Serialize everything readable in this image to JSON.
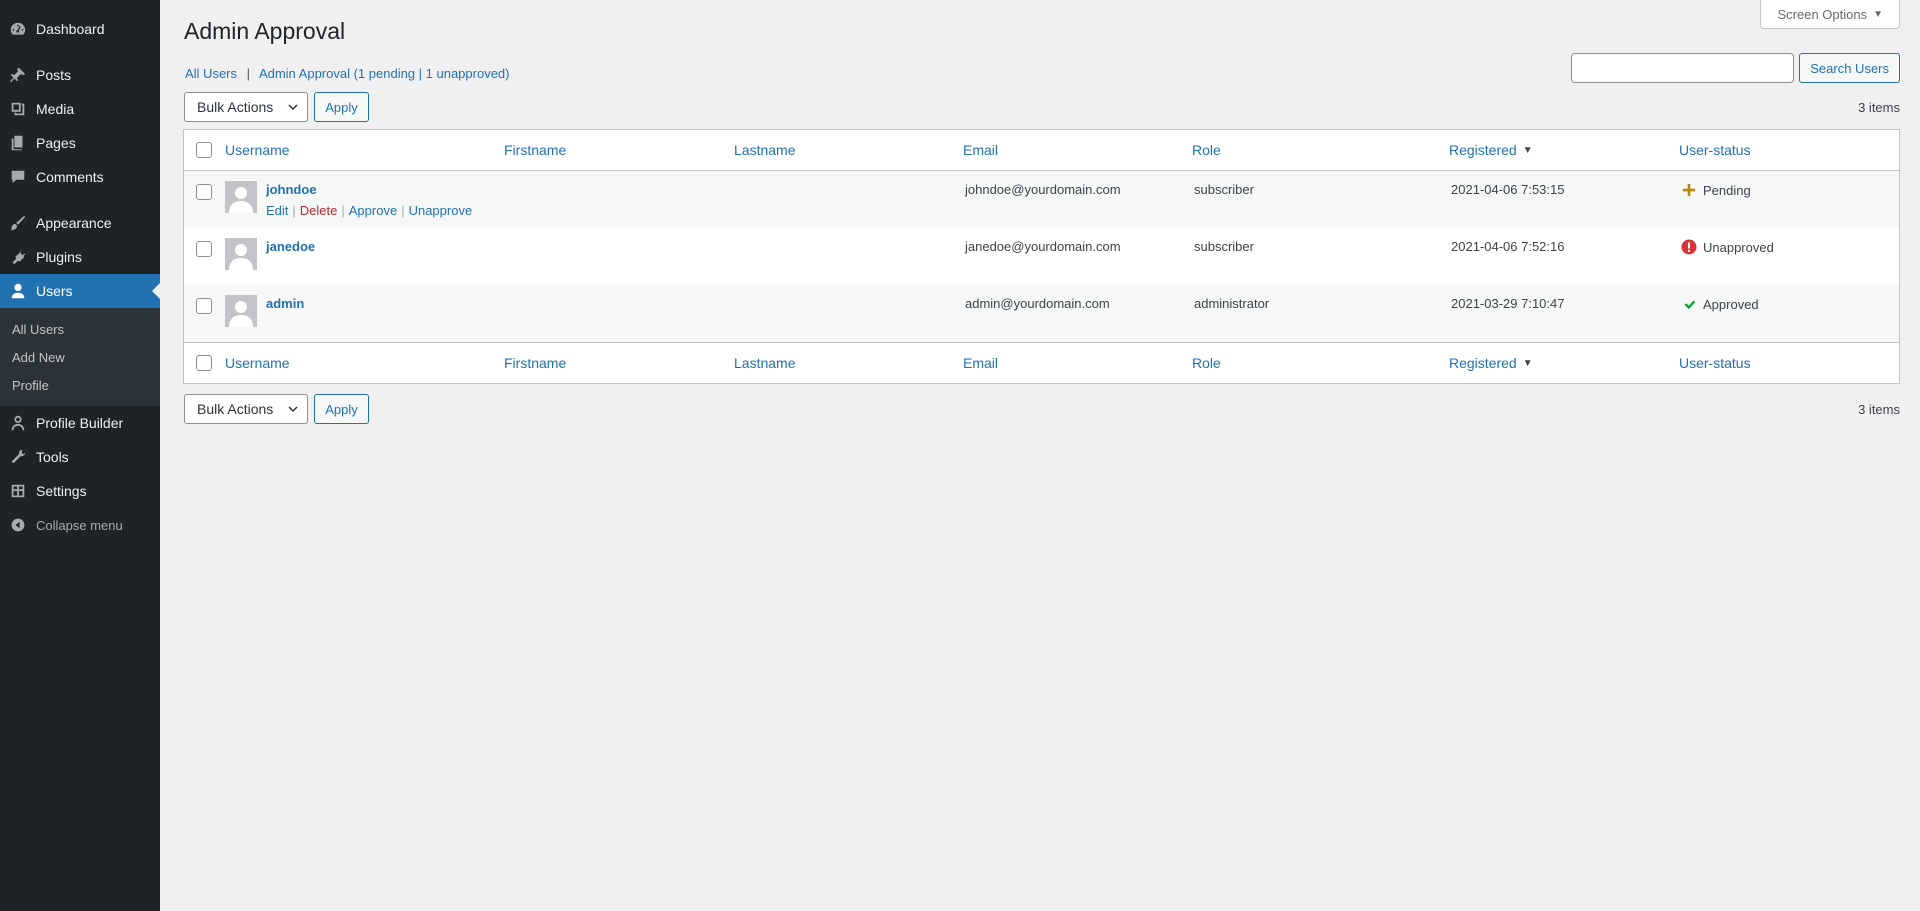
{
  "sidebar": {
    "items": [
      {
        "label": "Dashboard",
        "icon": "dashboard-icon"
      },
      {
        "label": "Posts",
        "icon": "pin-icon"
      },
      {
        "label": "Media",
        "icon": "media-icon"
      },
      {
        "label": "Pages",
        "icon": "pages-icon"
      },
      {
        "label": "Comments",
        "icon": "comment-icon"
      },
      {
        "label": "Appearance",
        "icon": "brush-icon"
      },
      {
        "label": "Plugins",
        "icon": "plug-icon"
      },
      {
        "label": "Users",
        "icon": "user-icon"
      },
      {
        "label": "Profile Builder",
        "icon": "user-outline-icon"
      },
      {
        "label": "Tools",
        "icon": "wrench-icon"
      },
      {
        "label": "Settings",
        "icon": "settings-icon"
      }
    ],
    "submenu": [
      "All Users",
      "Add New",
      "Profile"
    ],
    "collapse_label": "Collapse menu"
  },
  "header": {
    "screen_options": "Screen Options",
    "title": "Admin Approval"
  },
  "filters": {
    "all_users": "All Users",
    "admin_approval": "Admin Approval (1 pending | 1 unapproved)"
  },
  "search": {
    "button": "Search Users",
    "value": ""
  },
  "tablenav": {
    "bulk_actions": "Bulk Actions",
    "apply": "Apply",
    "count": "3 items"
  },
  "table": {
    "columns": {
      "username": "Username",
      "firstname": "Firstname",
      "lastname": "Lastname",
      "email": "Email",
      "role": "Role",
      "registered": "Registered",
      "status": "User-status"
    },
    "row_actions": {
      "edit": "Edit",
      "delete": "Delete",
      "approve": "Approve",
      "unapprove": "Unapprove"
    },
    "rows": [
      {
        "username": "johndoe",
        "email": "johndoe@yourdomain.com",
        "role": "subscriber",
        "registered": "2021-04-06 7:53:15",
        "status": "Pending",
        "status_color": "#b8860b"
      },
      {
        "username": "janedoe",
        "email": "janedoe@yourdomain.com",
        "role": "subscriber",
        "registered": "2021-04-06 7:52:16",
        "status": "Unapproved",
        "status_color": "#d63638"
      },
      {
        "username": "admin",
        "email": "admin@yourdomain.com",
        "role": "administrator",
        "registered": "2021-03-29 7:10:47",
        "status": "Approved",
        "status_color": "#00a32a"
      }
    ]
  }
}
